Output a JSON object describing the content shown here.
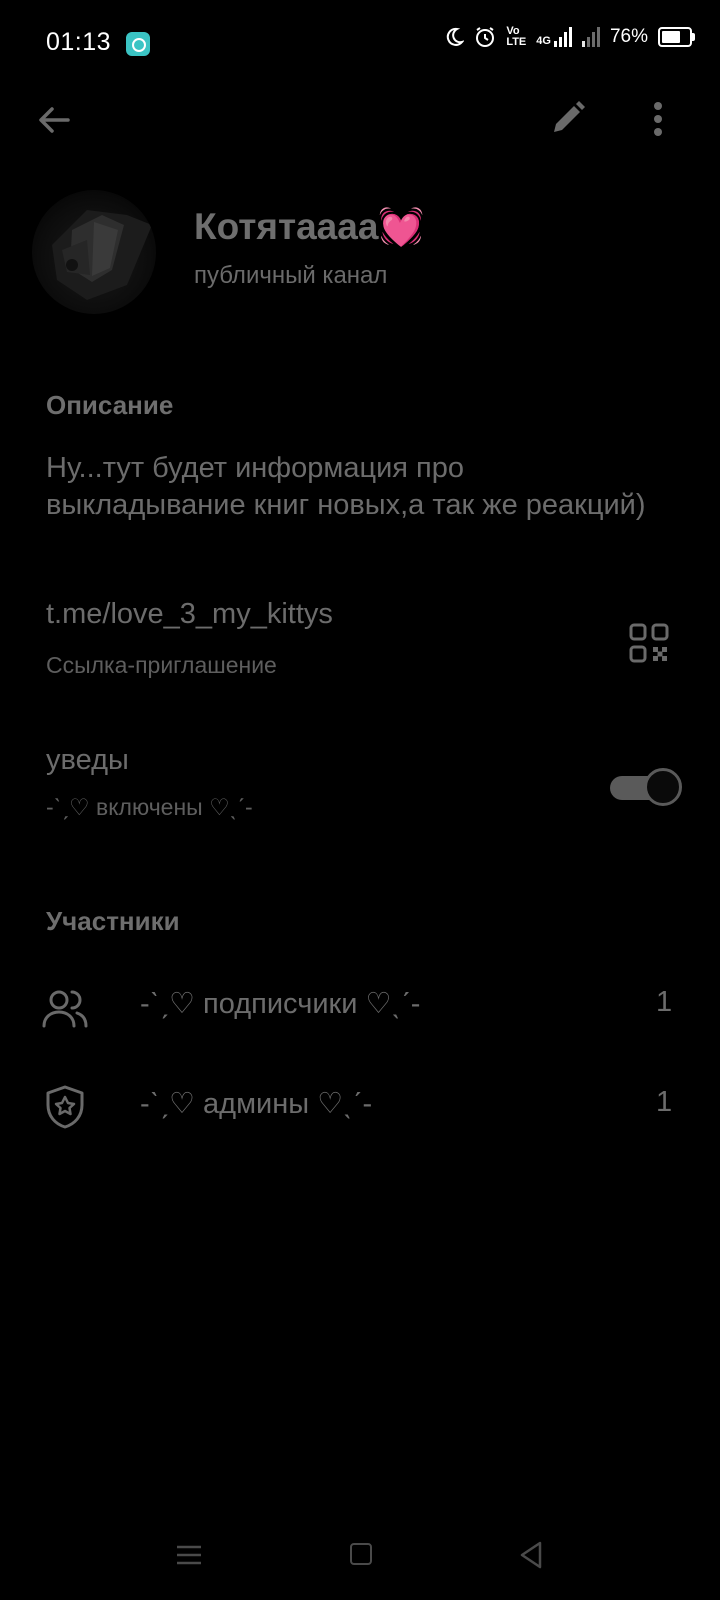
{
  "status_bar": {
    "time": "01:13",
    "network_label_top": "Vo",
    "network_label_bottom": "LTE",
    "network_type": "4G",
    "battery_percent": "76%",
    "battery_level": 0.76,
    "icons": [
      "moon-icon",
      "alarm-icon",
      "volte-icon",
      "signal-icon",
      "signal-icon",
      "battery-icon"
    ]
  },
  "toolbar": {
    "back_icon": "arrow-left-icon",
    "edit_icon": "pencil-icon",
    "more_icon": "more-vertical-icon"
  },
  "channel": {
    "name": "Котятаааа💓",
    "subtitle": "публичный канал"
  },
  "description": {
    "title": "Описание",
    "text": "Ну...тут будет информация про выкладывание книг новых,а так же реакций)"
  },
  "invite": {
    "link": "t.me/love_3_my_kittys",
    "label": "Ссылка-приглашение"
  },
  "notifications": {
    "title": "уведы",
    "status": "-ˋˏ♡ включены ♡ˎˊ-",
    "enabled": true
  },
  "members": {
    "title": "Участники",
    "rows": [
      {
        "icon": "people-icon",
        "label": "-ˋˏ♡ подписчики ♡ˎˊ-",
        "count": "1"
      },
      {
        "icon": "shield-star-icon",
        "label": "-ˋˏ♡ админы ♡ˎˊ-",
        "count": "1"
      }
    ]
  },
  "colors": {
    "background": "#000000",
    "text_dim": "#6c6c6c",
    "accent_heart": "#ff4fa0"
  }
}
